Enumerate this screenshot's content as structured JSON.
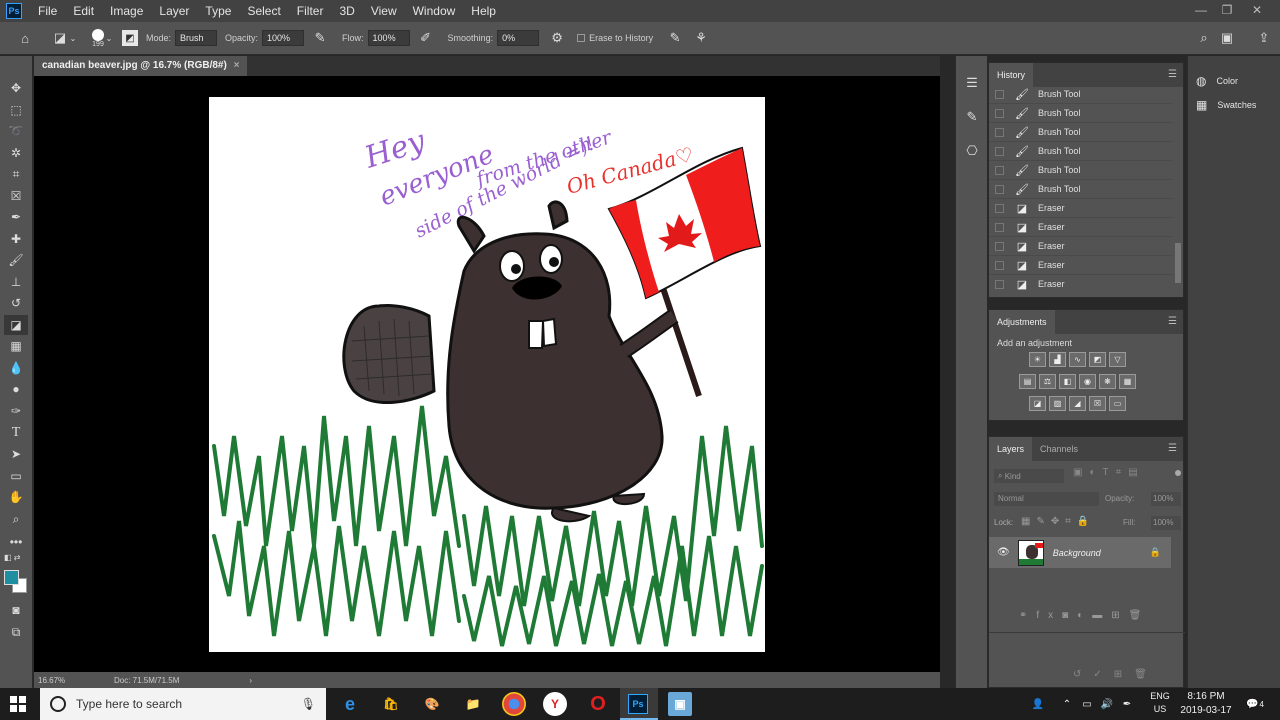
{
  "app": {
    "logo": "Ps"
  },
  "menu": [
    "File",
    "Edit",
    "Image",
    "Layer",
    "Type",
    "Select",
    "Filter",
    "3D",
    "View",
    "Window",
    "Help"
  ],
  "options_bar": {
    "brush_size": "199",
    "mode_label": "Mode:",
    "mode_value": "Brush",
    "opacity_label": "Opacity:",
    "opacity_value": "100%",
    "flow_label": "Flow:",
    "flow_value": "100%",
    "smoothing_label": "Smoothing:",
    "smoothing_value": "0%",
    "erase_history_label": "Erase to History"
  },
  "document": {
    "tab_title": "canadian beaver.jpg @ 16.7% (RGB/8#)",
    "zoom": "16.67%",
    "doc_size": "Doc: 71.5M/71.5M"
  },
  "artwork": {
    "line1": "Hey",
    "line2": "everyone",
    "line3": "from the other",
    "line4": "side of the world =)!",
    "line5": "Oh Canada♡"
  },
  "history": {
    "title": "History",
    "items": [
      {
        "label": "Brush Tool",
        "icon": "brush-icon"
      },
      {
        "label": "Brush Tool",
        "icon": "brush-icon"
      },
      {
        "label": "Brush Tool",
        "icon": "brush-icon"
      },
      {
        "label": "Brush Tool",
        "icon": "brush-icon"
      },
      {
        "label": "Brush Tool",
        "icon": "brush-icon"
      },
      {
        "label": "Brush Tool",
        "icon": "brush-icon"
      },
      {
        "label": "Eraser",
        "icon": "eraser-icon"
      },
      {
        "label": "Eraser",
        "icon": "eraser-icon"
      },
      {
        "label": "Eraser",
        "icon": "eraser-icon"
      },
      {
        "label": "Eraser",
        "icon": "eraser-icon"
      },
      {
        "label": "Eraser",
        "icon": "eraser-icon"
      }
    ]
  },
  "adjustments": {
    "title": "Adjustments",
    "subtitle": "Add an adjustment"
  },
  "layers": {
    "tab_layers": "Layers",
    "tab_channels": "Channels",
    "kind_filter": "Kind",
    "blend_mode": "Normal",
    "opacity_label": "Opacity:",
    "opacity_value": "100%",
    "lock_label": "Lock:",
    "fill_label": "Fill:",
    "fill_value": "100%",
    "layer_name": "Background"
  },
  "right_panels": {
    "color": "Color",
    "swatches": "Swatches"
  },
  "taskbar": {
    "search_placeholder": "Type here to search",
    "lang_top": "ENG",
    "lang_bottom": "US",
    "time": "8:16 PM",
    "date": "2019-03-17",
    "notifications": "4"
  },
  "colors": {
    "foreground": "#1e8fa0",
    "background": "#ffffff",
    "accent": "#31a8ff"
  }
}
